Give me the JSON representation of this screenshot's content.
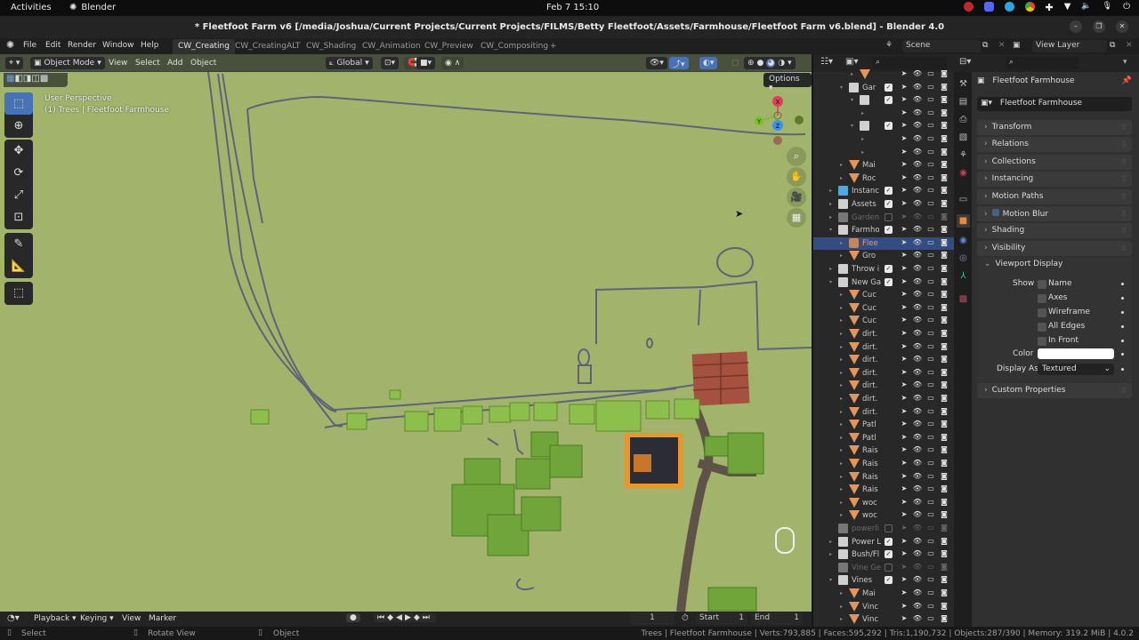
{
  "gnome": {
    "activities": "Activities",
    "app_name": "Blender",
    "clock": "Feb 7  15:10"
  },
  "window": {
    "title": "* Fleetfoot Farm v6 [/media/Joshua/Current Projects/Current Projects/FILMS/Betty Fleetfoot/Assets/Farmhouse/Fleetfoot Farm v6.blend] - Blender 4.0"
  },
  "menu": {
    "items": [
      "File",
      "Edit",
      "Render",
      "Window",
      "Help"
    ],
    "workspaces": [
      "CW_Creating",
      "CW_CreatingALT",
      "CW_Shading",
      "CW_Animation",
      "CW_Preview",
      "CW_Compositing"
    ],
    "active_workspace": "CW_Creating",
    "add_workspace": "+",
    "scene": "Scene",
    "view_layer": "View Layer"
  },
  "viewport": {
    "mode": "Object Mode",
    "menus": [
      "View",
      "Select",
      "Add",
      "Object"
    ],
    "orientation": "Global",
    "options": "Options",
    "overlay_line1": "User Perspective",
    "overlay_line2": "(1) Trees | Fleetfoot Farmhouse",
    "gizmo": {
      "x": "X",
      "y": "Y",
      "z": "Z"
    },
    "colors": {
      "ground": "#a2b46b",
      "x_axis": "#e23d5b",
      "y_axis": "#7cbd2a",
      "z_axis": "#3e8fe6",
      "selected_outline": "#f08a24"
    }
  },
  "timeline": {
    "menus": [
      "Playback",
      "Keying",
      "View",
      "Marker"
    ],
    "current_frame": "1",
    "start_label": "Start",
    "start": "1",
    "end_label": "End",
    "end": "1"
  },
  "status": {
    "left": [
      "Select",
      "Rotate View",
      "Object"
    ],
    "stats": "Trees | Fleetfoot Farmhouse | Verts:793,885 | Faces:595,292 | Tris:1,190,732 | Objects:287/390 | Memory: 319.2 MiB | 4.0.2"
  },
  "outliner": {
    "rows": [
      {
        "label": "",
        "type": "mesh",
        "indent": 4,
        "arrow": "▸",
        "checked": null,
        "dim": false
      },
      {
        "label": "Gar",
        "type": "collection",
        "indent": 3,
        "arrow": "▾",
        "checked": true,
        "dim": false
      },
      {
        "label": "",
        "type": "collection",
        "indent": 4,
        "arrow": "▾",
        "checked": true,
        "dim": false
      },
      {
        "label": "",
        "type": "none",
        "indent": 5,
        "arrow": "▸",
        "checked": null,
        "dim": false
      },
      {
        "label": "",
        "type": "collection",
        "indent": 4,
        "arrow": "▾",
        "checked": true,
        "dim": false
      },
      {
        "label": "",
        "type": "none",
        "indent": 5,
        "arrow": "▸",
        "checked": null,
        "dim": false
      },
      {
        "label": "",
        "type": "none",
        "indent": 5,
        "arrow": "▸",
        "checked": null,
        "dim": false
      },
      {
        "label": "Mai",
        "type": "mesh",
        "indent": 3,
        "arrow": "▸",
        "checked": null,
        "dim": false
      },
      {
        "label": "Roc",
        "type": "mesh",
        "indent": 3,
        "arrow": "▸",
        "checked": null,
        "dim": false
      },
      {
        "label": "Instanc",
        "type": "collection-blue",
        "indent": 2,
        "arrow": "▸",
        "checked": true,
        "dim": false
      },
      {
        "label": "Assets",
        "type": "collection",
        "indent": 2,
        "arrow": "▸",
        "checked": true,
        "dim": false
      },
      {
        "label": "Garden",
        "type": "collection-grey",
        "indent": 2,
        "arrow": "▸",
        "checked": false,
        "dim": true
      },
      {
        "label": "Farmho",
        "type": "collection",
        "indent": 2,
        "arrow": "▾",
        "checked": true,
        "dim": false
      },
      {
        "label": "Flee",
        "type": "empty-selected",
        "indent": 3,
        "arrow": "▸",
        "checked": null,
        "dim": false,
        "selected": true
      },
      {
        "label": "Gro",
        "type": "mesh",
        "indent": 3,
        "arrow": "▸",
        "checked": null,
        "dim": false
      },
      {
        "label": "Throw i",
        "type": "collection",
        "indent": 2,
        "arrow": "▸",
        "checked": true,
        "dim": false
      },
      {
        "label": "New Ga",
        "type": "collection",
        "indent": 2,
        "arrow": "▾",
        "checked": true,
        "dim": false
      },
      {
        "label": "Cuc",
        "type": "mesh",
        "indent": 3,
        "arrow": "▸",
        "checked": null,
        "dim": false
      },
      {
        "label": "Cuc",
        "type": "mesh",
        "indent": 3,
        "arrow": "▸",
        "checked": null,
        "dim": false
      },
      {
        "label": "Cuc",
        "type": "mesh",
        "indent": 3,
        "arrow": "▸",
        "checked": null,
        "dim": false
      },
      {
        "label": "dirt.",
        "type": "mesh",
        "indent": 3,
        "arrow": "▸",
        "checked": null,
        "dim": false
      },
      {
        "label": "dirt.",
        "type": "mesh",
        "indent": 3,
        "arrow": "▸",
        "checked": null,
        "dim": false
      },
      {
        "label": "dirt.",
        "type": "mesh",
        "indent": 3,
        "arrow": "▸",
        "checked": null,
        "dim": false
      },
      {
        "label": "dirt.",
        "type": "mesh",
        "indent": 3,
        "arrow": "▸",
        "checked": null,
        "dim": false
      },
      {
        "label": "dirt.",
        "type": "mesh",
        "indent": 3,
        "arrow": "▸",
        "checked": null,
        "dim": false
      },
      {
        "label": "dirt.",
        "type": "mesh",
        "indent": 3,
        "arrow": "▸",
        "checked": null,
        "dim": false
      },
      {
        "label": "dirt.",
        "type": "mesh",
        "indent": 3,
        "arrow": "▸",
        "checked": null,
        "dim": false
      },
      {
        "label": "Patl",
        "type": "mesh",
        "indent": 3,
        "arrow": "▸",
        "checked": null,
        "dim": false
      },
      {
        "label": "Patl",
        "type": "mesh",
        "indent": 3,
        "arrow": "▸",
        "checked": null,
        "dim": false
      },
      {
        "label": "Rais",
        "type": "mesh",
        "indent": 3,
        "arrow": "▸",
        "checked": null,
        "dim": false
      },
      {
        "label": "Rais",
        "type": "mesh",
        "indent": 3,
        "arrow": "▸",
        "checked": null,
        "dim": false
      },
      {
        "label": "Rais",
        "type": "mesh",
        "indent": 3,
        "arrow": "▸",
        "checked": null,
        "dim": false
      },
      {
        "label": "Rais",
        "type": "mesh",
        "indent": 3,
        "arrow": "▸",
        "checked": null,
        "dim": false
      },
      {
        "label": "woc",
        "type": "mesh",
        "indent": 3,
        "arrow": "▸",
        "checked": null,
        "dim": false
      },
      {
        "label": "woc",
        "type": "mesh",
        "indent": 3,
        "arrow": "▸",
        "checked": null,
        "dim": false
      },
      {
        "label": "powerli",
        "type": "collection-grey",
        "indent": 2,
        "arrow": "",
        "checked": false,
        "dim": true
      },
      {
        "label": "Power L",
        "type": "collection",
        "indent": 2,
        "arrow": "▸",
        "checked": true,
        "dim": false
      },
      {
        "label": "Bush/Fl",
        "type": "collection",
        "indent": 2,
        "arrow": "▸",
        "checked": true,
        "dim": false
      },
      {
        "label": "Vine Ge",
        "type": "collection-grey",
        "indent": 2,
        "arrow": "",
        "checked": false,
        "dim": true
      },
      {
        "label": "Vines",
        "type": "collection",
        "indent": 2,
        "arrow": "▾",
        "checked": true,
        "dim": false
      },
      {
        "label": "Mai",
        "type": "mesh",
        "indent": 3,
        "arrow": "▸",
        "checked": null,
        "dim": false
      },
      {
        "label": "Vinc",
        "type": "mesh",
        "indent": 3,
        "arrow": "▸",
        "checked": null,
        "dim": false
      },
      {
        "label": "Vinc",
        "type": "mesh",
        "indent": 3,
        "arrow": "▸",
        "checked": null,
        "dim": false
      }
    ]
  },
  "properties": {
    "object_name": "Fleetfoot Farmhouse",
    "object_field": "Fleetfoot Farmhouse",
    "panels": [
      "Transform",
      "Relations",
      "Collections",
      "Instancing",
      "Motion Paths",
      "Motion Blur",
      "Shading",
      "Visibility"
    ],
    "viewport_display": {
      "title": "Viewport Display",
      "show_label": "Show",
      "options": [
        {
          "label": "Name",
          "checked": false
        },
        {
          "label": "Axes",
          "checked": false
        },
        {
          "label": "Wireframe",
          "checked": false
        },
        {
          "label": "All Edges",
          "checked": false
        },
        {
          "label": "In Front",
          "checked": false
        }
      ],
      "color_label": "Color",
      "color_value": "#ffffff",
      "display_as_label": "Display As",
      "display_as_value": "Textured"
    },
    "custom_properties": "Custom Properties"
  }
}
